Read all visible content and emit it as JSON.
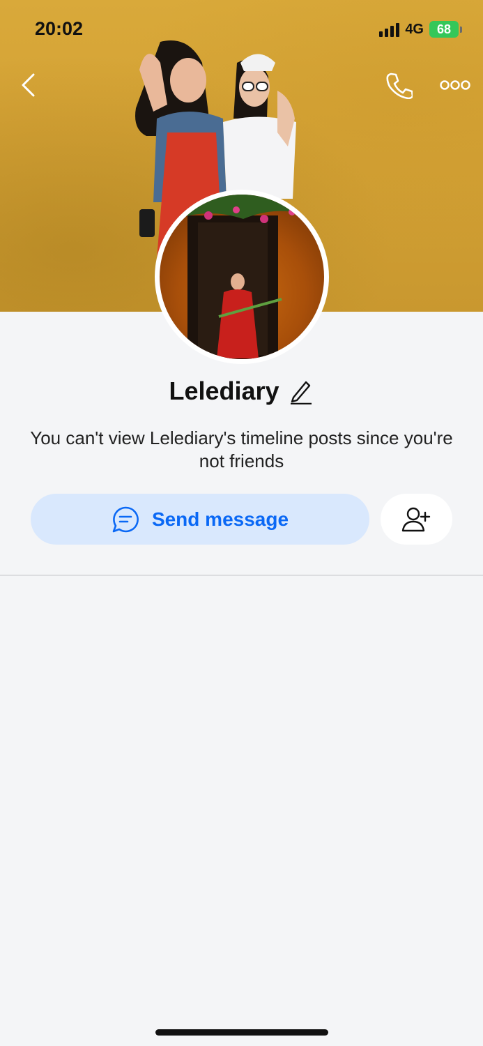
{
  "status_bar": {
    "time": "20:02",
    "network": "4G",
    "battery": "68"
  },
  "nav": {
    "back_icon": "chevron-left-icon",
    "call_icon": "phone-icon",
    "more_icon": "more-dots-icon"
  },
  "profile": {
    "name": "Lelediary",
    "edit_icon": "pencil-icon",
    "notice": "You can't view Lelediary's timeline posts since you're not friends"
  },
  "actions": {
    "send_message_label": "Send message",
    "send_message_icon": "chat-bubble-icon",
    "add_friend_icon": "add-user-icon"
  },
  "colors": {
    "accent": "#0a68f5",
    "send_button_bg": "#d9e8fd",
    "battery_green": "#34c759",
    "cover_mustard": "#d4a235"
  }
}
